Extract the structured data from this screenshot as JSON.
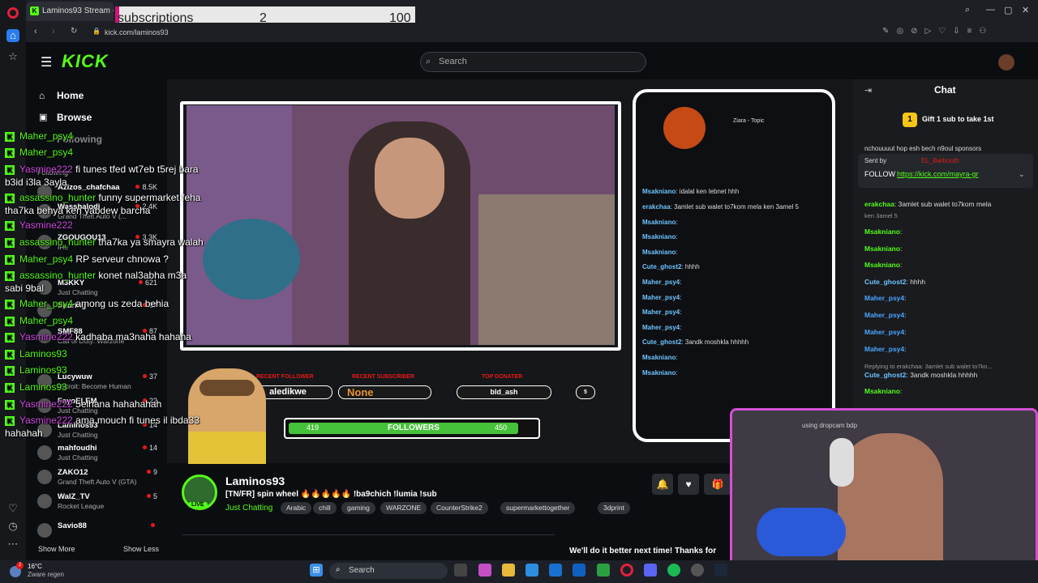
{
  "browser": {
    "tab_title": "Laminos93 Stream - Wat",
    "url": "kick.com/laminos93"
  },
  "subs_overlay": {
    "label": "subscriptions",
    "current": "2",
    "goal": "100"
  },
  "header": {
    "search_placeholder": "Search"
  },
  "sidebar": {
    "nav": [
      {
        "label": "Home"
      },
      {
        "label": "Browse"
      },
      {
        "label": "Following"
      }
    ],
    "following_heading": "Following",
    "channels": [
      {
        "name": "Azizos_chafchaa",
        "game": "",
        "viewers": "8.5K"
      },
      {
        "name": "Wasshalodi",
        "game": "Grand Theft Auto V (...",
        "viewers": "2.4K"
      },
      {
        "name": "ZGOUGOU13",
        "game": "IRL",
        "viewers": "3.3K"
      },
      {
        "name": "M3KKY",
        "game": "Just Chatting",
        "viewers": "621"
      },
      {
        "name": "Sharing",
        "game": "",
        "viewers": "87"
      },
      {
        "name": "SMF88",
        "game": "Call of Duty: Warzone",
        "viewers": "87"
      },
      {
        "name": "Lucywuw",
        "game": "Detroit: Become Human",
        "viewers": "37"
      },
      {
        "name": "FayoELEM",
        "game": "Just Chatting",
        "viewers": "22"
      },
      {
        "name": "Laminos93",
        "game": "Just Chatting",
        "viewers": "14"
      },
      {
        "name": "mahfoudhi",
        "game": "Just Chatting",
        "viewers": "14"
      },
      {
        "name": "ZAKO12",
        "game": "Grand Theft Auto V (GTA)",
        "viewers": "9"
      },
      {
        "name": "WalZ_TV",
        "game": "Rocket League",
        "viewers": "5"
      },
      {
        "name": "Savio88",
        "game": "",
        "viewers": ""
      }
    ],
    "show_more": "Show More",
    "show_less": "Show Less"
  },
  "stream_overlay": {
    "chat_header": "Ziara - Topic",
    "chat_lines": [
      {
        "user": "Msakniano",
        "msg": ": idalal ken lebnet hhh"
      },
      {
        "user": "erakchaa",
        "msg": ": 3amlet sub walet to7kom mela ken 3amel 5"
      },
      {
        "user": "Msakniano",
        "msg": ":"
      },
      {
        "user": "Msakniano",
        "msg": ":"
      },
      {
        "user": "Msakniano",
        "msg": ":"
      },
      {
        "user": "Cute_ghost2",
        "msg": ": hhhh"
      },
      {
        "user": "Maher_psy4",
        "msg": ":"
      },
      {
        "user": "Maher_psy4",
        "msg": ":"
      },
      {
        "user": "Maher_psy4",
        "msg": ":"
      },
      {
        "user": "Maher_psy4",
        "msg": ":"
      },
      {
        "user": "Cute_ghost2",
        "msg": ": 3andk moshkla hhhhh"
      },
      {
        "user": "Msakniano",
        "msg": ":"
      },
      {
        "user": "Msakniano",
        "msg": ":"
      }
    ],
    "recent_follower_label": "RECENT FOLLOWER",
    "recent_follower": "aledikwe",
    "recent_subscriber_label": "RECENT SUBSCRIBER",
    "recent_subscriber": "None",
    "top_donater_label": "TOP DONATER",
    "top_donater": "bld_ash",
    "misc": "5",
    "followers_current": "419",
    "followers_label": "FOLLOWERS",
    "followers_goal": "450",
    "followers_progress": 0.93
  },
  "stream_info": {
    "streamer": "Laminos93",
    "live": "LIVE",
    "title": "[TN/FR] spin wheel 🔥🔥🔥🔥🔥 !ba9chich !lumia !sub",
    "category": "Just Chatting",
    "tags": [
      "Arabic",
      "chill",
      "gaming",
      "WARZONE",
      "CounterStrike2",
      "supermarkettogether",
      "3dprint"
    ],
    "promo_text": "We'll do it better next time! Thanks for"
  },
  "chat_panel": {
    "title": "Chat",
    "gift": "Gift 1 sub to take 1st",
    "gift_count": "1",
    "pinned_scroll": "nchouuuut    hop    esh bech n9oul    sponsors",
    "pinned_sender_label": "Sent by",
    "pinned_sender": "EL_Barbouth",
    "pinned_text": "FOLLOW",
    "pinned_link": "https://kick.com/mayra-gr",
    "messages": [
      {
        "user": "erakchaa",
        "msg": ": 3amlet sub walet to7kom mela"
      },
      {
        "user": "",
        "msg": "ken 3amel 5"
      },
      {
        "user": "Msakniano",
        "msg": ":"
      },
      {
        "user": "Msakniano",
        "msg": ":"
      },
      {
        "user": "Msakniano",
        "msg": ":"
      },
      {
        "user": "Cute_ghost2",
        "msg": ": hhhh"
      },
      {
        "user": "Maher_psy4",
        "msg": ":"
      },
      {
        "user": "Maher_psy4",
        "msg": ":"
      },
      {
        "user": "Maher_psy4",
        "msg": ":"
      },
      {
        "user": "Maher_psy4",
        "msg": ":"
      },
      {
        "user": "",
        "msg": "Replying to erakchaa: 3amlet sub walet to7ko..."
      },
      {
        "user": "Cute_ghost2",
        "msg": ": 3andk moshkla hhhhh"
      },
      {
        "user": "Msakniano",
        "msg": ":"
      }
    ]
  },
  "overlay_chat": [
    {
      "user": "Maher_psy4",
      "msg": ""
    },
    {
      "user": "Maher_psy4",
      "msg": ""
    },
    {
      "user": "Yasmine222",
      "msg": " fi tunes tfed wt7eb t5rej bara"
    },
    {
      "user": "",
      "msg": "b3id i3la 3ayla"
    },
    {
      "user": "assassino_hunter",
      "msg": " funny supermarket feha"
    },
    {
      "user": "",
      "msg": "tha7ka behya ken yabdew barcha"
    },
    {
      "user": "Yasmine222",
      "msg": ""
    },
    {
      "user": "assassino_hunter",
      "msg": " tha7ka ya smayra walah"
    },
    {
      "user": "Maher_psy4",
      "msg": " RP serveur chnowa ?"
    },
    {
      "user": "assassino_hunter",
      "msg": " konet nal3abha m3a"
    },
    {
      "user": "",
      "msg": "sabi 9bal"
    },
    {
      "user": "Maher_psy4",
      "msg": " among us zeda behia"
    },
    {
      "user": "Maher_psy4",
      "msg": ""
    },
    {
      "user": "Yasmine222",
      "msg": " kadhaba ma3naha hahaha"
    },
    {
      "user": "Laminos93",
      "msg": ""
    },
    {
      "user": "Laminos93",
      "msg": ""
    },
    {
      "user": "Laminos93",
      "msg": ""
    },
    {
      "user": "Yasmine222",
      "msg": " 5elhana hahahahah"
    },
    {
      "user": "Yasmine222",
      "msg": " ama mouch fi tunes il ibda33"
    },
    {
      "user": "",
      "msg": "hahahah"
    }
  ],
  "facecam": {
    "mirror_text": "using dropcam bdp"
  },
  "taskbar": {
    "temp": "16°C",
    "weather": "Zware regen",
    "search": "Search",
    "notif_count": "2"
  },
  "colors": {
    "kick_green": "#53fc18",
    "facecam_border": "#d64fd6",
    "live_red": "#e91916"
  }
}
